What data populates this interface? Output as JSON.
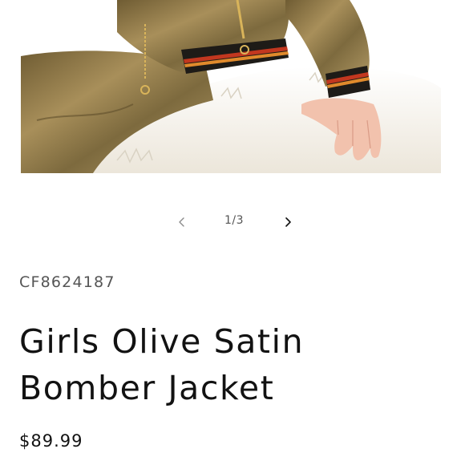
{
  "gallery": {
    "counter": "1/3",
    "prev_icon": "chevron-left-icon",
    "next_icon": "chevron-right-icon"
  },
  "product": {
    "sku": "CF8624187",
    "title": "Girls Olive Satin Bomber Jacket",
    "price": "$89.99"
  },
  "colors": {
    "jacket": "#8a7446",
    "stripe_red": "#c2371f",
    "stripe_orange": "#e08a2c",
    "fur": "#f3efe6"
  }
}
